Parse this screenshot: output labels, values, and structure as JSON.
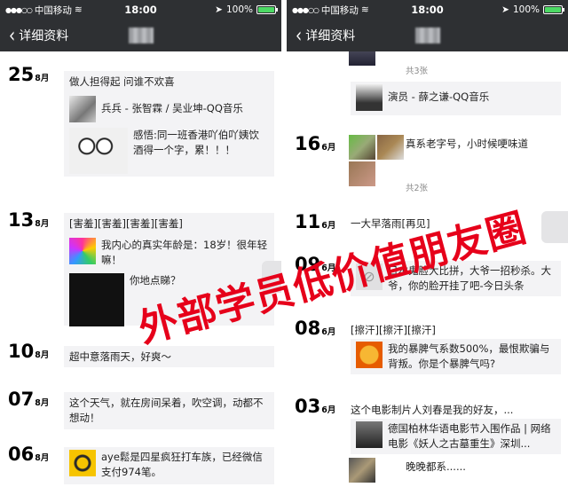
{
  "status": {
    "carrier": "中国移动",
    "time": "18:00",
    "battery": "100%",
    "battery_level": 1.0
  },
  "nav": {
    "back_label": "详细资料"
  },
  "left": {
    "entries": [
      {
        "day": "25",
        "month": "8月",
        "text": "做人担得起  问谁不欢喜",
        "music": "兵兵 - 张智霖 / 吴业坤-QQ音乐",
        "caption": "感悟:同一班香港吖伯吖姨饮酒得一个字，累！！！"
      },
      {
        "day": "13",
        "month": "8月",
        "text": "[害羞][害羞][害羞][害羞]",
        "share1": "我内心的真实年龄是：18岁！很年轻嘛！",
        "share2": "你地点睇？"
      },
      {
        "day": "10",
        "month": "8月",
        "text": "超中意落雨天，好爽～"
      },
      {
        "day": "07",
        "month": "8月",
        "text": "这个天气，就在房间呆着，吹空调，动都不想动！"
      },
      {
        "day": "06",
        "month": "8月",
        "text": "aye鬆是四星疯狂打车族，已经微信支付974笔。"
      }
    ]
  },
  "right": {
    "entries": [
      {
        "count": "共3张"
      },
      {
        "music": "演员 - 薛之谦-QQ音乐"
      },
      {
        "day": "16",
        "month": "6月",
        "text": "真系老字号，小时候哽味道",
        "count": "共2张"
      },
      {
        "day": "11",
        "month": "6月",
        "text": "一大早落雨[再见]"
      },
      {
        "day": "09",
        "month": "6月",
        "text": "日本鬼脸大比拼，大爷一招秒杀。大爷，你的脸开挂了吧-今日头条"
      },
      {
        "day": "08",
        "month": "6月",
        "text": "[擦汗][擦汗][擦汗]",
        "share": "我的暴脾气系数500%，最恨欺骗与背叛。你是个暴脾气吗?"
      },
      {
        "day": "03",
        "month": "6月",
        "text": "这个电影制片人刘春是我的好友，...",
        "share": "德国柏林华语电影节入围作品 | 网络电影《妖人之古墓重生》深圳...",
        "caption": "晚晚都系......"
      }
    ]
  },
  "watermark": "外部学员低价值朋友圈"
}
